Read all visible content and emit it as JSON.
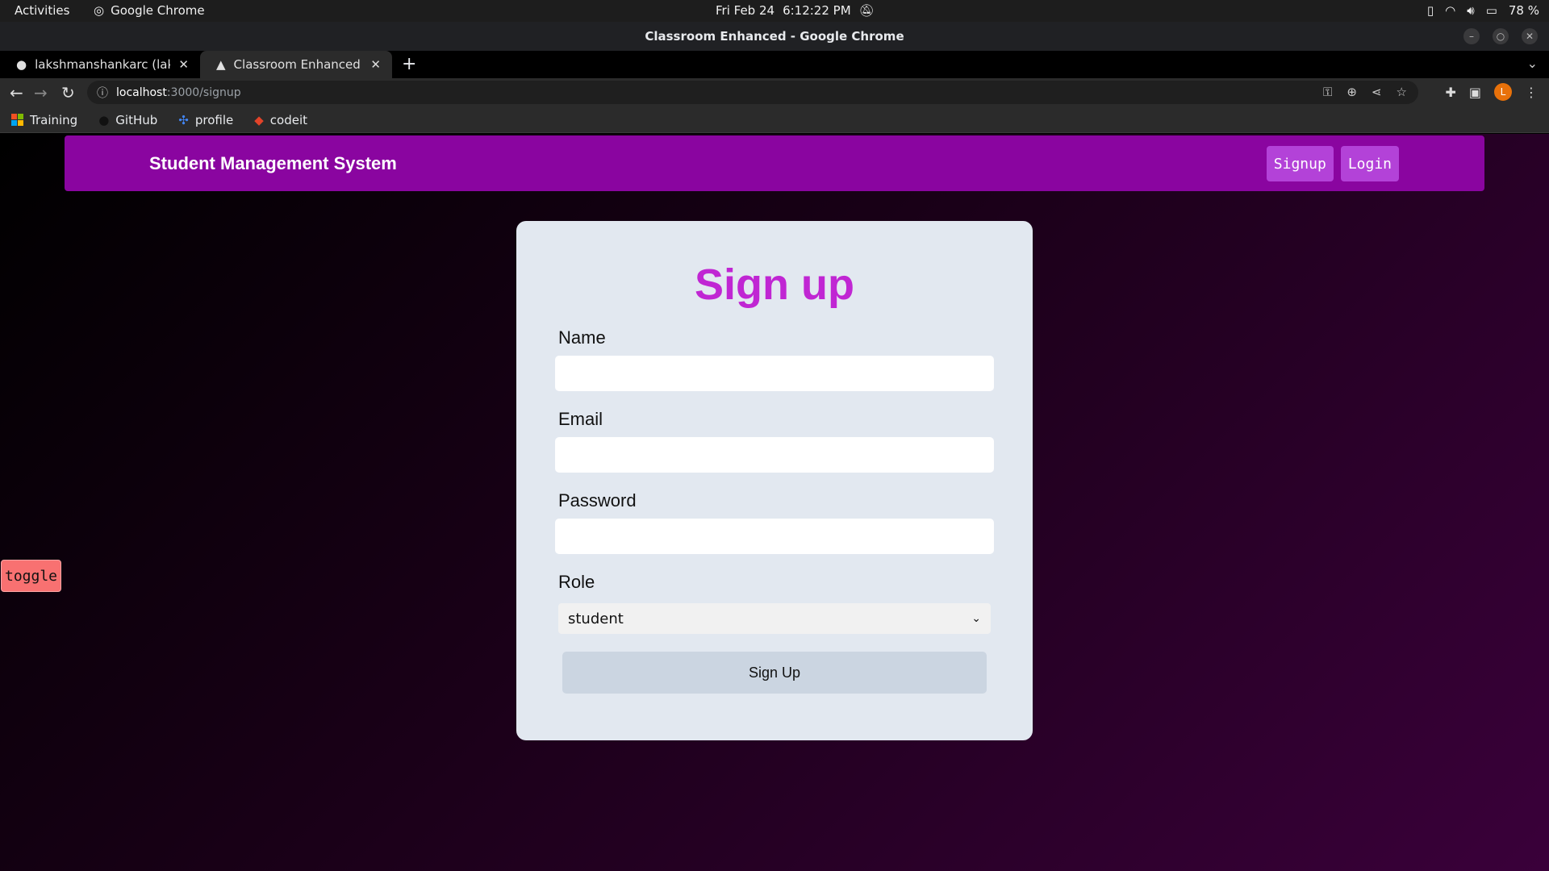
{
  "system_bar": {
    "activities": "Activities",
    "app_name": "Google Chrome",
    "date": "Fri Feb 24",
    "time": "6:12:22 PM",
    "battery": "78 %"
  },
  "window": {
    "title": "Classroom Enhanced - Google Chrome"
  },
  "tabs": [
    {
      "label": "lakshmanshankarc (laksh",
      "active": false
    },
    {
      "label": "Classroom Enhanced",
      "active": true
    }
  ],
  "address": {
    "host": "localhost",
    "path": ":3000/signup"
  },
  "bookmarks": [
    {
      "label": "Training",
      "icon": "microsoft-icon"
    },
    {
      "label": "GitHub",
      "icon": "github-icon"
    },
    {
      "label": "profile",
      "icon": "pinwheel-icon"
    },
    {
      "label": "codeit",
      "icon": "gitlab-icon"
    }
  ],
  "profile_initial": "L",
  "navbar": {
    "brand": "Student Management System",
    "signup": "Signup",
    "login": "Login"
  },
  "form": {
    "title": "Sign up",
    "name_label": "Name",
    "email_label": "Email",
    "password_label": "Password",
    "role_label": "Role",
    "role_value": "student",
    "submit": "Sign Up"
  },
  "toggle": "toggle",
  "colors": {
    "navbar": "#8a05a0",
    "nav_button": "#b342d8",
    "title": "#c026d3",
    "card": "#e2e8f0",
    "toggle": "#f87171"
  }
}
